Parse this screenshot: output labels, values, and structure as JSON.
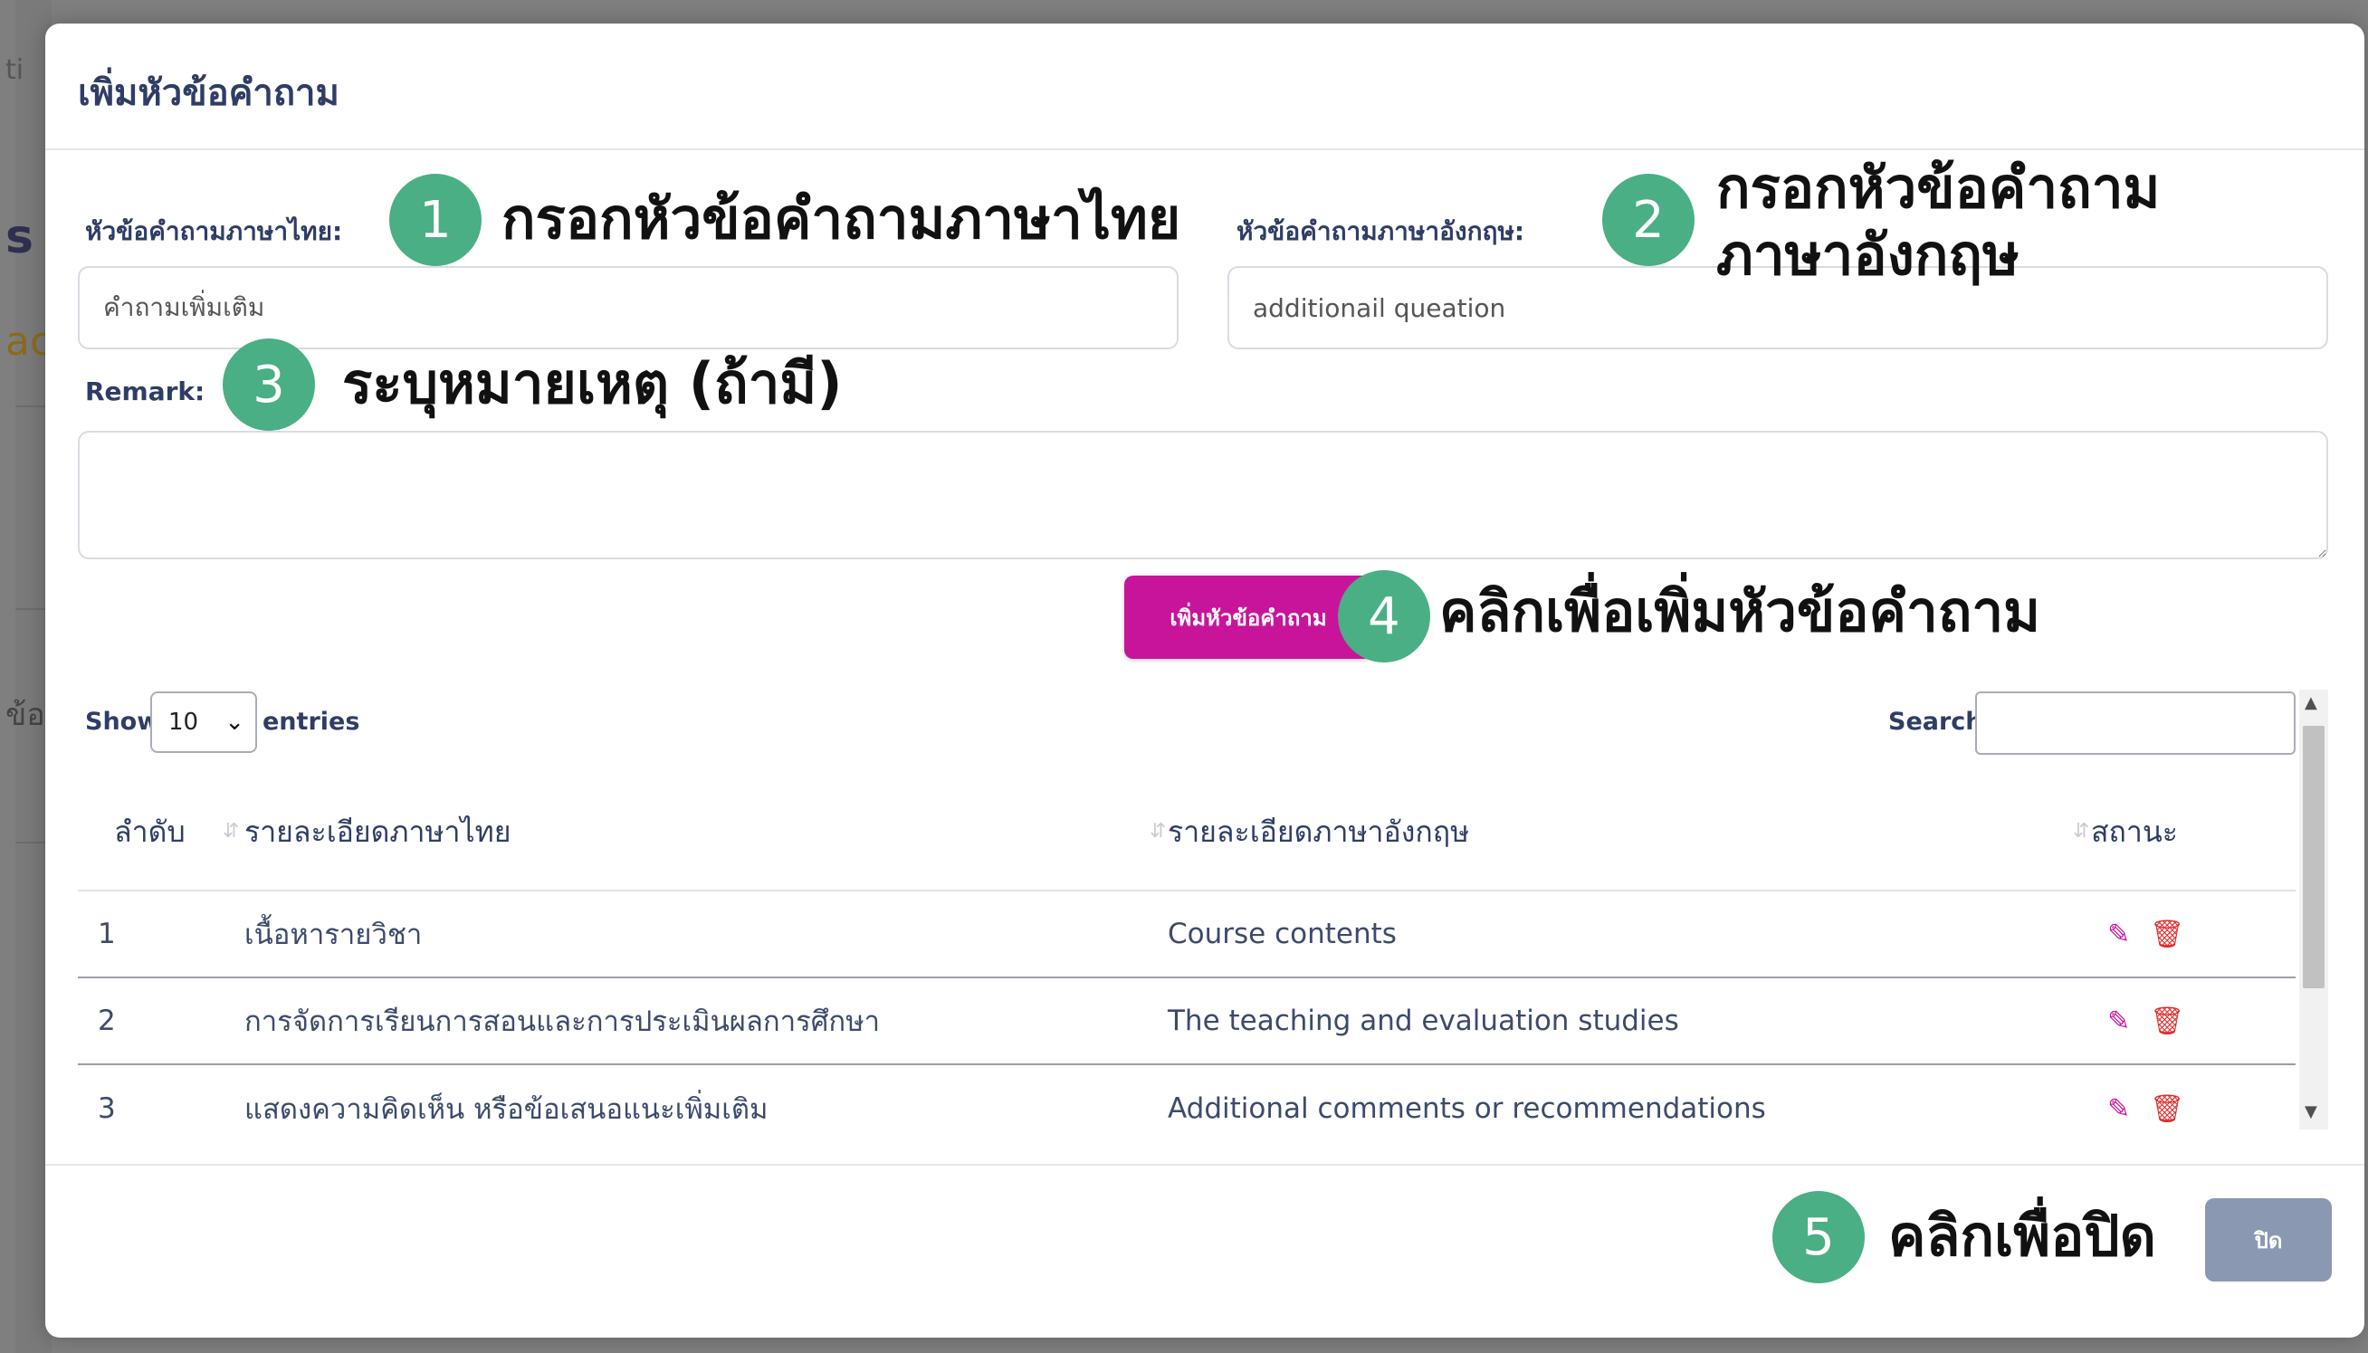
{
  "background": {
    "fragments": [
      "ti",
      "s",
      "ac",
      "ข้อ"
    ]
  },
  "modal": {
    "title": "เพิ่มหัวข้อคำถาม",
    "thai_label": "หัวข้อคำถามภาษาไทย:",
    "thai_value": "คำถามเพิ่มเติม",
    "english_label": "หัวข้อคำถามภาษาอังกฤษ:",
    "english_value": "additionail queation",
    "remark_label": "Remark:",
    "remark_value": "",
    "add_button": "เพิ่มหัวข้อคำถาม",
    "close_button": "ปิด"
  },
  "annotations": [
    {
      "number": "1",
      "text": "กรอกหัวข้อคำถามภาษาไทย"
    },
    {
      "number": "2",
      "text_line1": "กรอกหัวข้อคำถาม",
      "text_line2": "ภาษาอังกฤษ"
    },
    {
      "number": "3",
      "text": "ระบุหมายเหตุ (ถ้ามี)"
    },
    {
      "number": "4",
      "text": "คลิกเพื่อเพิ่มหัวข้อคำถาม"
    },
    {
      "number": "5",
      "text": "คลิกเพื่อปิด"
    }
  ],
  "table_controls": {
    "show_label": "Show",
    "entries_value": "10",
    "entries_label": "entries",
    "search_label": "Search:"
  },
  "table": {
    "headers": [
      "ลำดับ",
      "รายละเอียดภาษาไทย",
      "รายละเอียดภาษาอังกฤษ",
      "สถานะ"
    ],
    "rows": [
      {
        "no": "1",
        "thai": "เนื้อหารายวิชา",
        "english": "Course contents"
      },
      {
        "no": "2",
        "thai": "การจัดการเรียนการสอนและการประเมินผลการศึกษา",
        "english": "The teaching and evaluation studies"
      },
      {
        "no": "3",
        "thai": "แสดงความคิดเห็น หรือข้อเสนอแนะเพิ่มเติม",
        "english": "Additional comments or recommendations"
      }
    ]
  },
  "colors": {
    "accent_magenta": "#c8149b",
    "badge_green": "#4aaf84",
    "title_navy": "#2f3d66",
    "close_gray_blue": "#8a98b2",
    "delete_red": "#e03030"
  }
}
